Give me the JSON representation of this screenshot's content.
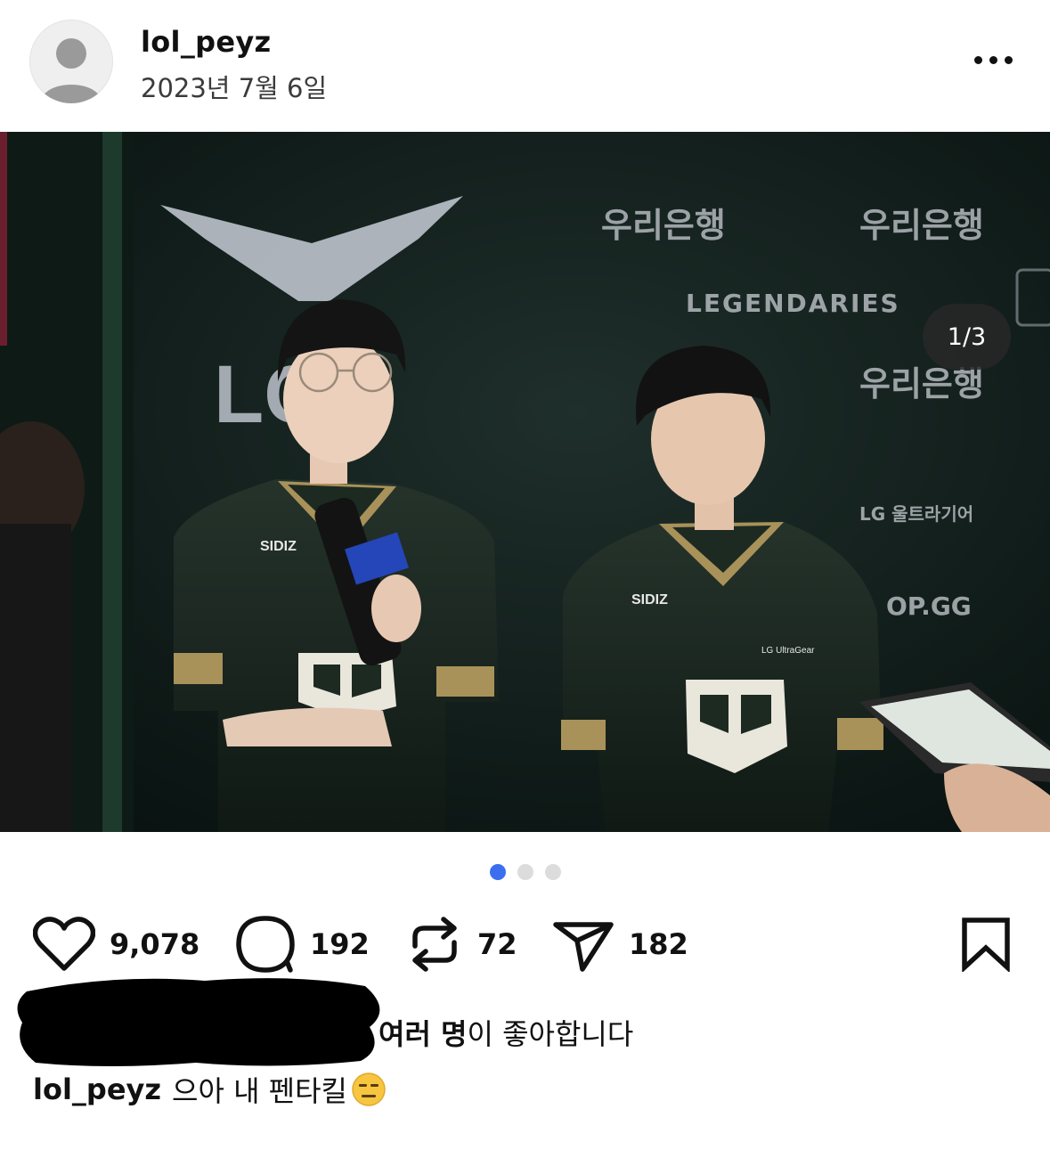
{
  "post": {
    "username": "lol_peyz",
    "date": "2023년 7월 6일",
    "more_icon": "more-horizontal-icon"
  },
  "media": {
    "counter": "1/3",
    "total": 3,
    "current": 1,
    "scene": {
      "backdrop_text": [
        "우리은행",
        "우리은행",
        "LEGENDARIES",
        "우리은행",
        "OP.GG",
        "LG 울트라기어"
      ],
      "logo_text": "LCK",
      "jersey_text": [
        "SIDIZ",
        "SIDIZ",
        "LG UltraGear"
      ]
    }
  },
  "actions": {
    "likes": "9,078",
    "comments": "192",
    "reposts": "72",
    "shares": "182",
    "icons": [
      "heart-icon",
      "comment-icon",
      "repost-icon",
      "send-icon",
      "bookmark-icon"
    ]
  },
  "liked_by": {
    "bold": "여러 명",
    "rest": "이 좋아합니다"
  },
  "caption": {
    "username": "lol_peyz",
    "text": "으아 내 펜타킬",
    "emoji": "expressionless-face-emoji"
  },
  "colors": {
    "accent_dot": "#3b6ff0",
    "jersey": "#1d2a22",
    "gold": "#a8925a"
  }
}
